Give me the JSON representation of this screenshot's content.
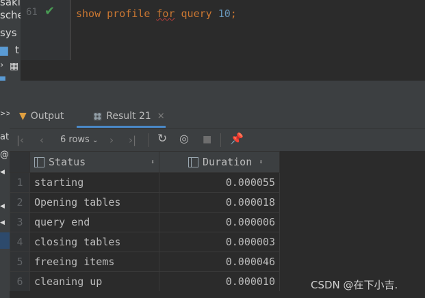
{
  "sidebar": {
    "items": [
      "sakil",
      "sche",
      "sys",
      "t",
      ""
    ],
    "lower_items": [
      ">>",
      "ata",
      "@",
      "",
      "",
      ""
    ]
  },
  "editor": {
    "line_number": "61",
    "code_tokens": [
      "show",
      "profile",
      "for",
      "query",
      "10",
      ";"
    ]
  },
  "tabs": {
    "output_label": "Output",
    "result_label": "Result 21"
  },
  "toolbar": {
    "rows_label": "6 rows"
  },
  "table": {
    "columns": [
      "Status",
      "Duration"
    ],
    "rows": [
      {
        "n": "1",
        "status": "starting",
        "duration": "0.000055"
      },
      {
        "n": "2",
        "status": "Opening tables",
        "duration": "0.000018"
      },
      {
        "n": "3",
        "status": "query end",
        "duration": "0.000006"
      },
      {
        "n": "4",
        "status": "closing tables",
        "duration": "0.000003"
      },
      {
        "n": "5",
        "status": "freeing items",
        "duration": "0.000046"
      },
      {
        "n": "6",
        "status": "cleaning up",
        "duration": "0.000010"
      }
    ]
  },
  "watermark": "CSDN @在下小吉.",
  "colors": {
    "keyword": "#cc7832",
    "number": "#6897bb",
    "success": "#499c54",
    "accent": "#4a88c7"
  }
}
